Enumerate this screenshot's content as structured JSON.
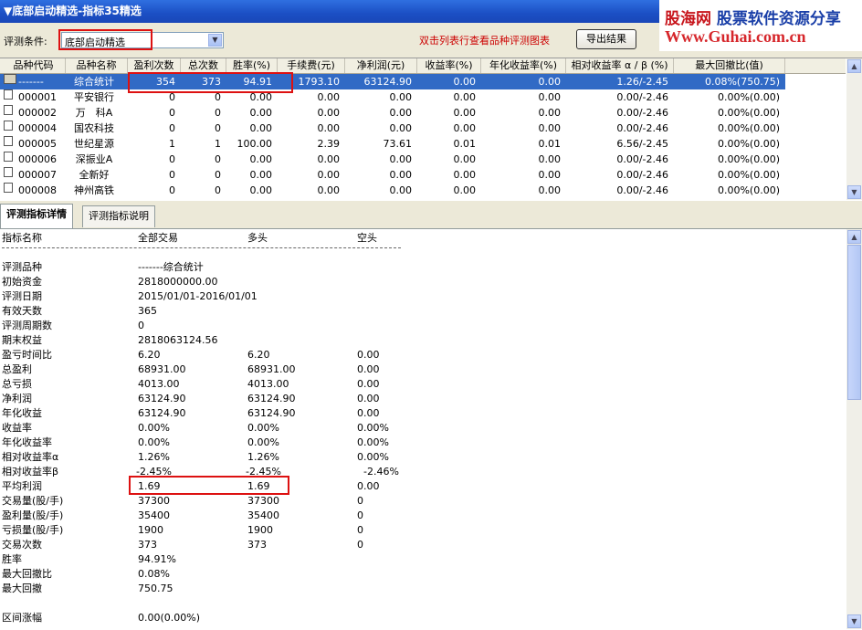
{
  "window": {
    "title": "▼底部启动精选-指标35精选"
  },
  "watermark": {
    "line1_red": "股海网",
    "line1_blue": "股票软件资源分享",
    "line2": "Www.Guhai.com.cn"
  },
  "condition": {
    "label": "评测条件:",
    "value": "底部启动精选",
    "hint": "双击列表行查看品种评测图表",
    "export_label": "导出结果"
  },
  "table": {
    "headers": [
      "品种代码",
      "品种名称",
      "盈利次数",
      "总次数",
      "胜率(%)",
      "手续费(元)",
      "净利润(元)",
      "收益率(%)",
      "年化收益率(%)",
      "相对收益率 α / β (%)",
      "最大回撤比(值)"
    ],
    "rows": [
      [
        "-------",
        "综合统计",
        "354",
        "373",
        "94.91",
        "1793.10",
        "63124.90",
        "0.00",
        "0.00",
        "1.26/-2.45",
        "0.08%(750.75)"
      ],
      [
        "000001",
        "平安银行",
        "0",
        "0",
        "0.00",
        "0.00",
        "0.00",
        "0.00",
        "0.00",
        "0.00/-2.46",
        "0.00%(0.00)"
      ],
      [
        "000002",
        "万　科A",
        "0",
        "0",
        "0.00",
        "0.00",
        "0.00",
        "0.00",
        "0.00",
        "0.00/-2.46",
        "0.00%(0.00)"
      ],
      [
        "000004",
        "国农科技",
        "0",
        "0",
        "0.00",
        "0.00",
        "0.00",
        "0.00",
        "0.00",
        "0.00/-2.46",
        "0.00%(0.00)"
      ],
      [
        "000005",
        "世纪星源",
        "1",
        "1",
        "100.00",
        "2.39",
        "73.61",
        "0.01",
        "0.01",
        "6.56/-2.45",
        "0.00%(0.00)"
      ],
      [
        "000006",
        "深振业A",
        "0",
        "0",
        "0.00",
        "0.00",
        "0.00",
        "0.00",
        "0.00",
        "0.00/-2.46",
        "0.00%(0.00)"
      ],
      [
        "000007",
        "全新好",
        "0",
        "0",
        "0.00",
        "0.00",
        "0.00",
        "0.00",
        "0.00",
        "0.00/-2.46",
        "0.00%(0.00)"
      ],
      [
        "000008",
        "神州高铁",
        "0",
        "0",
        "0.00",
        "0.00",
        "0.00",
        "0.00",
        "0.00",
        "0.00/-2.46",
        "0.00%(0.00)"
      ]
    ]
  },
  "tabs": [
    "评测指标详情",
    "评测指标说明"
  ],
  "detail": {
    "headers": [
      "指标名称",
      "全部交易",
      "多头",
      "空头"
    ],
    "rows": [
      [
        "评测品种",
        "-------综合统计",
        "",
        ""
      ],
      [
        "初始资金",
        "2818000000.00",
        "",
        ""
      ],
      [
        "评测日期",
        "2015/01/01-2016/01/01",
        "",
        ""
      ],
      [
        "有效天数",
        "365",
        "",
        ""
      ],
      [
        "评测周期数",
        "0",
        "",
        ""
      ],
      [
        "期末权益",
        "2818063124.56",
        "",
        ""
      ],
      [
        "盈亏时间比",
        "6.20",
        "6.20",
        "0.00"
      ],
      [
        "总盈利",
        "68931.00",
        "68931.00",
        "0.00"
      ],
      [
        "总亏损",
        "4013.00",
        "4013.00",
        "0.00"
      ],
      [
        "净利润",
        "63124.90",
        "63124.90",
        "0.00"
      ],
      [
        "年化收益",
        "63124.90",
        "63124.90",
        "0.00"
      ],
      [
        "收益率",
        "0.00%",
        "0.00%",
        "0.00%"
      ],
      [
        "年化收益率",
        "0.00%",
        "0.00%",
        "0.00%"
      ],
      [
        "相对收益率α",
        "1.26%",
        "1.26%",
        "0.00%"
      ],
      [
        "相对收益率β",
        "-2.45%",
        "-2.45%",
        "-2.46%"
      ],
      [
        "平均利润",
        "1.69",
        "1.69",
        "0.00"
      ],
      [
        "交易量(股/手)",
        "37300",
        "37300",
        "0"
      ],
      [
        "盈利量(股/手)",
        "35400",
        "35400",
        "0"
      ],
      [
        "亏损量(股/手)",
        "1900",
        "1900",
        "0"
      ],
      [
        "交易次数",
        "373",
        "373",
        "0"
      ],
      [
        "胜率",
        "94.91%",
        "",
        ""
      ],
      [
        "最大回撤比",
        "0.08%",
        "",
        ""
      ],
      [
        "最大回撤",
        "750.75",
        "",
        ""
      ],
      [
        "",
        "",
        "",
        ""
      ],
      [
        "区间涨幅",
        "0.00(0.00%)",
        "",
        ""
      ]
    ]
  }
}
